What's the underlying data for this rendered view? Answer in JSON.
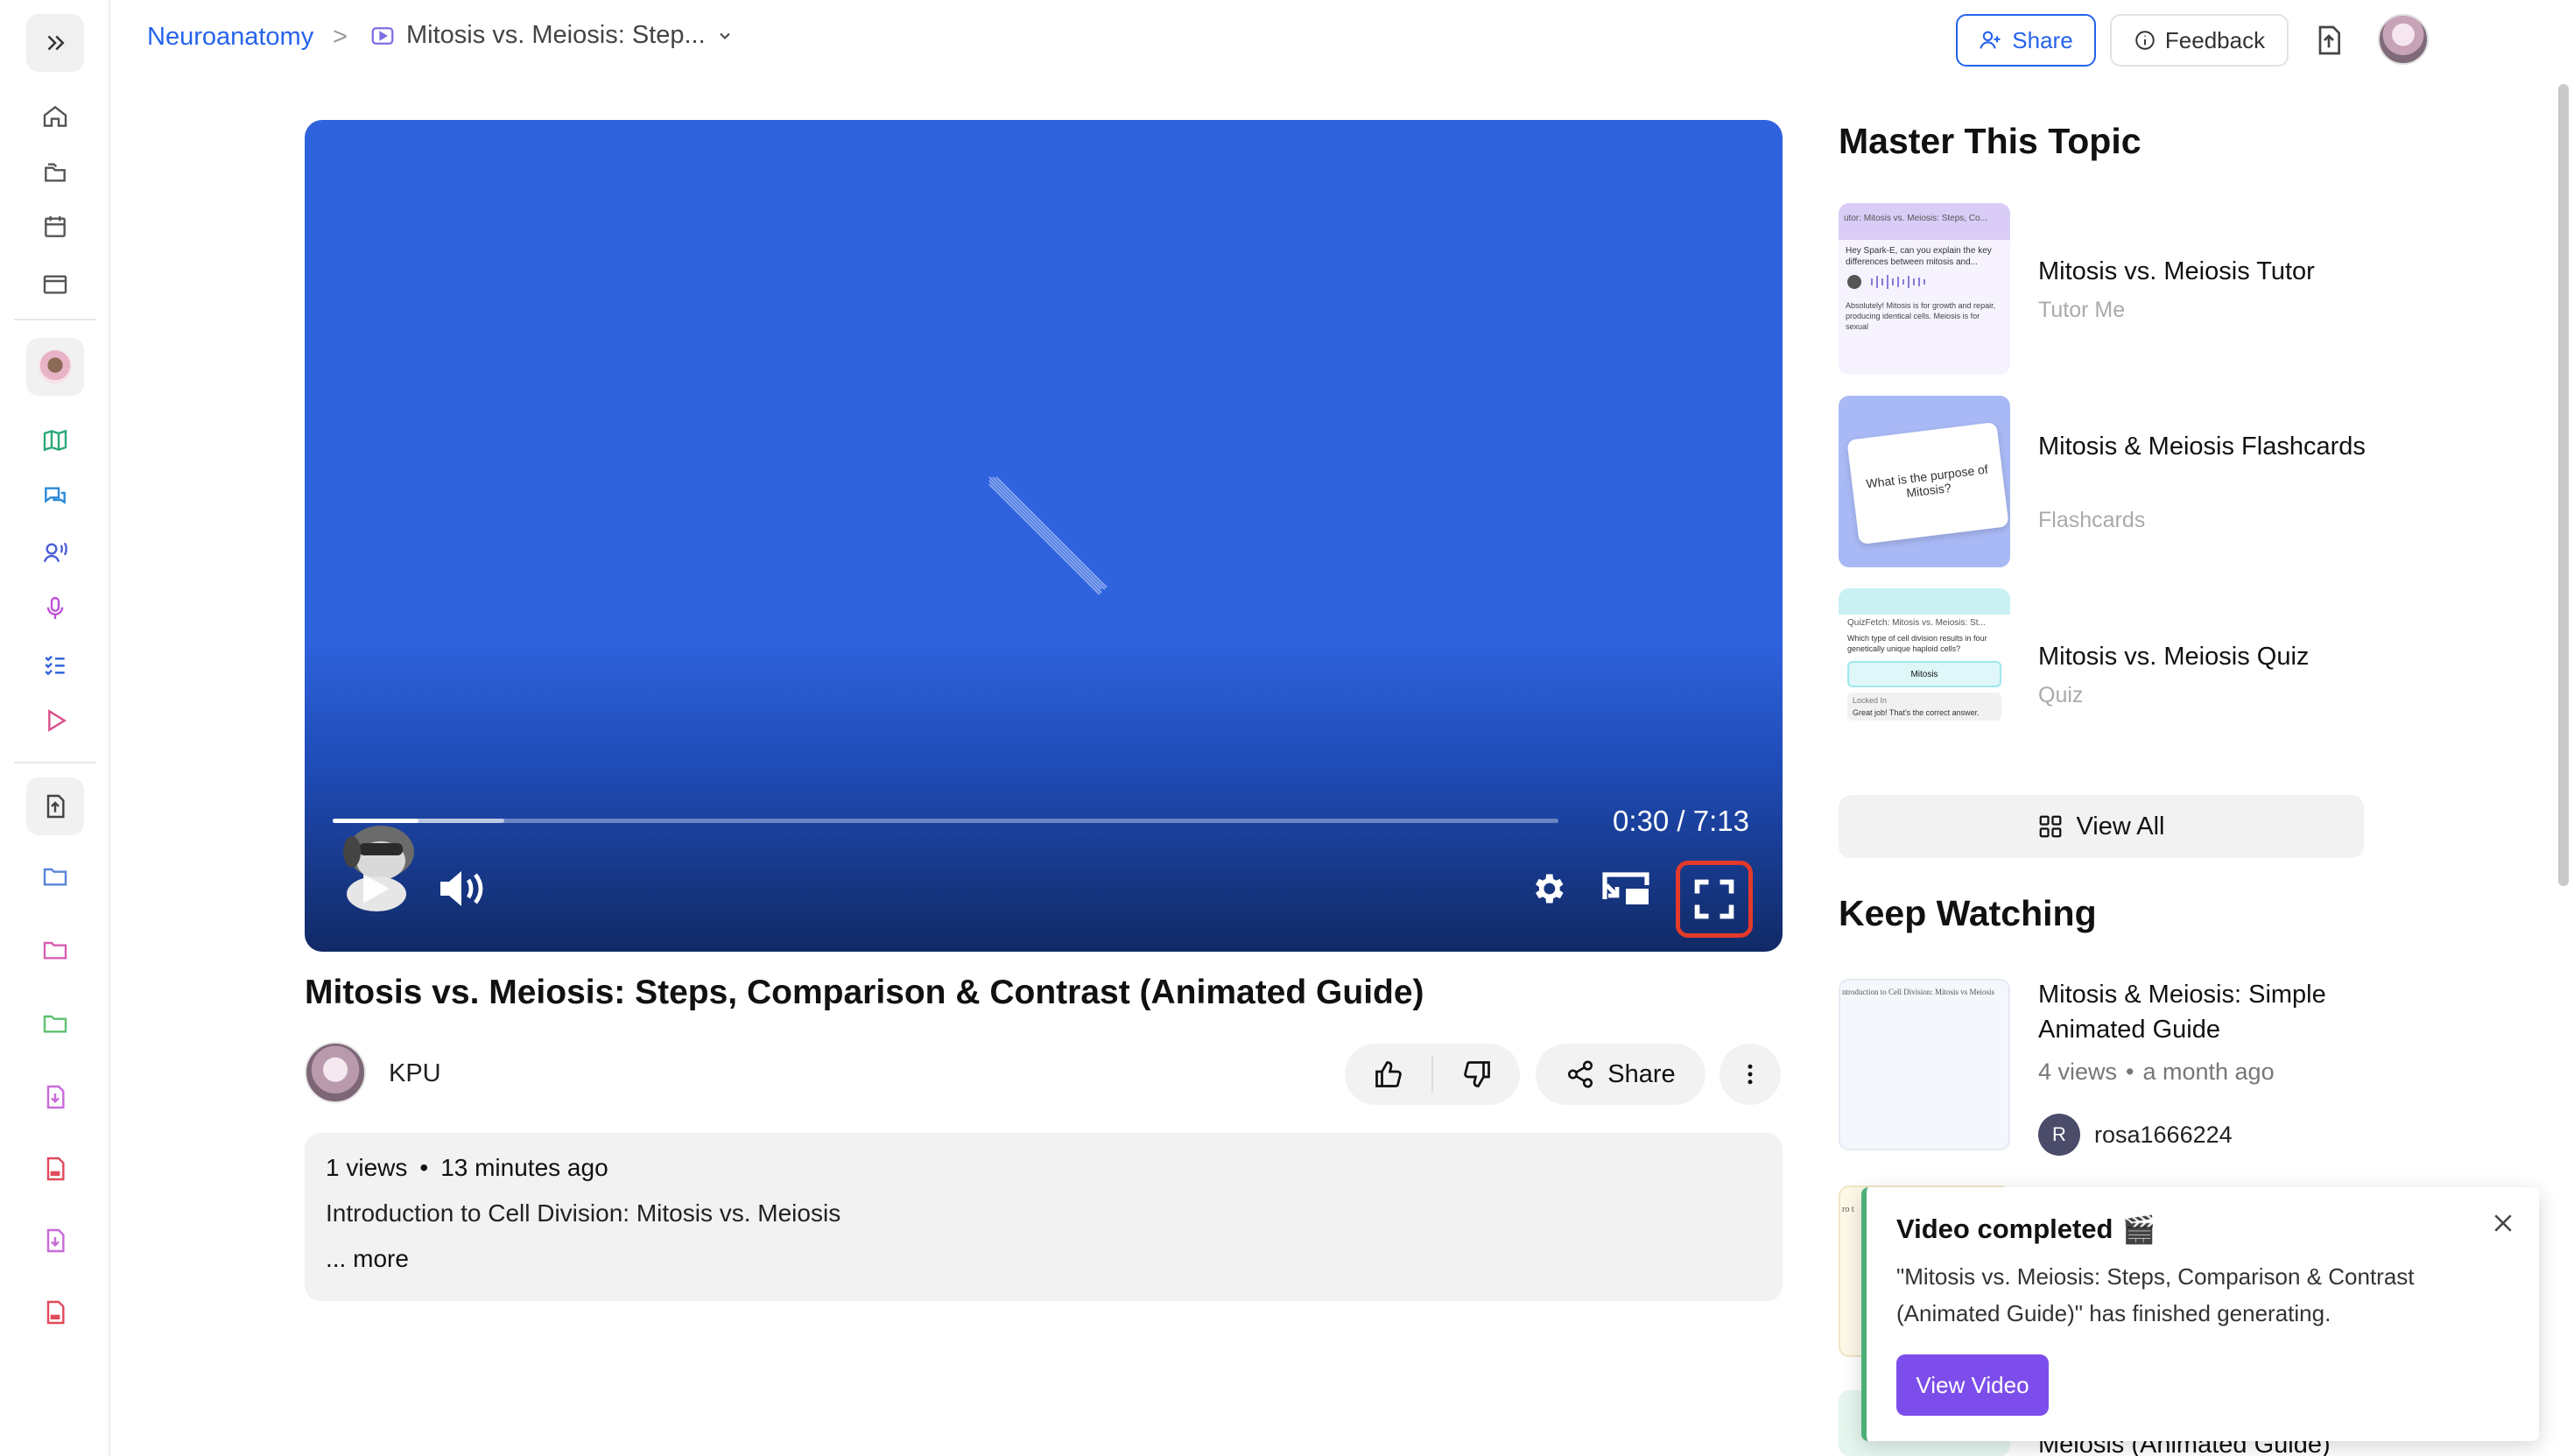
{
  "sidebar": {
    "expand_icon": "double-chevron-right-icon",
    "nav_icons": [
      "home-icon",
      "folders-icon",
      "calendar-icon",
      "browser-window-icon",
      "mascot-avatar-icon",
      "map-icon",
      "chat-bubbles-icon",
      "voice-tutor-icon",
      "microphone-icon",
      "checklist-icon",
      "play-icon",
      "upload-file-icon",
      "folder-icon",
      "folder-pink-icon",
      "folder-green-icon",
      "download-file-icon",
      "pdf-icon",
      "download-file-icon",
      "pdf-icon"
    ]
  },
  "breadcrumb": {
    "root": "Neuroanatomy",
    "separator": ">",
    "page": "Mitosis vs. Meiosis: Step..."
  },
  "header": {
    "share_label": "Share",
    "feedback_label": "Feedback"
  },
  "player": {
    "time": "0:30 / 7:13",
    "progress_fraction": 0.07,
    "buffered_fraction": 0.14
  },
  "video": {
    "title": "Mitosis vs. Meiosis: Steps, Comparison & Contrast (Animated Guide)",
    "channel": "KPU",
    "share_label": "Share",
    "views": "1 views",
    "dot": "•",
    "age": "13 minutes ago",
    "description": "Introduction to Cell Division: Mitosis vs. Meiosis",
    "more": "... more"
  },
  "master": {
    "heading": "Master This Topic",
    "items": [
      {
        "title": "Mitosis vs. Meiosis Tutor",
        "sub": "Tutor Me",
        "thumb": {
          "header": "utor: Mitosis vs. Meiosis: Steps, Co...",
          "q": "Hey Spark-E, can you explain the key differences between mitosis and...",
          "a": "Absolutely! Mitosis is for growth and repair, producing identical cells. Meiosis is for sexual"
        }
      },
      {
        "title": "Mitosis & Meiosis Flashcards",
        "sub": "Flashcards",
        "thumb": {
          "card": "What is the purpose of Mitosis?"
        }
      },
      {
        "title": "Mitosis vs. Meiosis Quiz",
        "sub": "Quiz",
        "thumb": {
          "header": "QuizFetch: Mitosis vs. Meiosis: St...",
          "q": "Which type of cell division results in four genetically unique haploid cells?",
          "answer": "Mitosis",
          "locked": "Locked In",
          "feedback": "Great job! That's the correct answer."
        }
      }
    ],
    "view_all": "View All"
  },
  "keep_watching": {
    "heading": "Keep Watching",
    "items": [
      {
        "title": "Mitosis & Meiosis: Simple Animated Guide",
        "views": "4 views",
        "dot": "•",
        "age": "a month ago",
        "uploader_initial": "R",
        "uploader": "rosa1666224",
        "thumb_text": "ntroduction to Cell Division: Mitosis vs Meiosis"
      },
      {
        "title": "Meiosis (Animated Guide)",
        "thumb_text": "ro t"
      }
    ]
  },
  "toast": {
    "title": "Video completed",
    "emoji": "🎬",
    "body": "\"Mitosis vs. Meiosis: Steps, Comparison & Contrast (Animated Guide)\" has finished generating.",
    "button": "View Video"
  },
  "colors": {
    "accent_blue": "#2563eb",
    "player_blue": "#2f63de",
    "highlight_red": "#e33a2c",
    "toast_green": "#4caf7a",
    "button_purple": "#7c4dea"
  }
}
